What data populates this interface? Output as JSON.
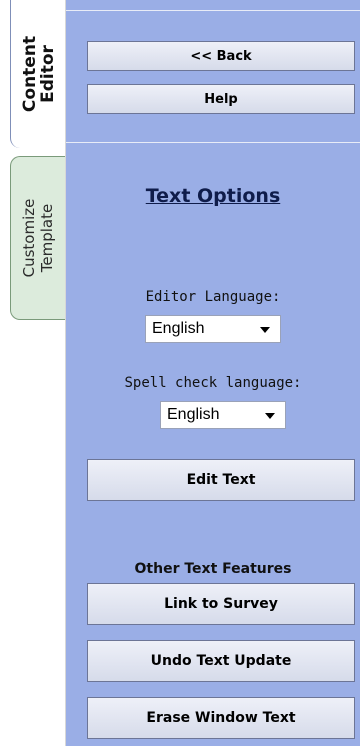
{
  "tabs": {
    "content_editor": "Content\nEditor",
    "customize_template": "Customize\nTemplate"
  },
  "nav": {
    "back_label": "<< Back",
    "help_label": "Help"
  },
  "text_options": {
    "heading": "Text Options",
    "editor_language_label": "Editor Language:",
    "editor_language_value": "English",
    "spell_check_label": "Spell check language:",
    "spell_check_value": "English",
    "edit_text_label": "Edit Text"
  },
  "other_features": {
    "heading": "Other Text Features",
    "link_to_survey_label": "Link to Survey",
    "undo_text_update_label": "Undo Text Update",
    "erase_window_text_label": "Erase Window Text"
  },
  "colors": {
    "panel_bg": "#9aaee6",
    "customize_tab_bg": "#dcebdc",
    "heading_text": "#0f1c4a"
  }
}
